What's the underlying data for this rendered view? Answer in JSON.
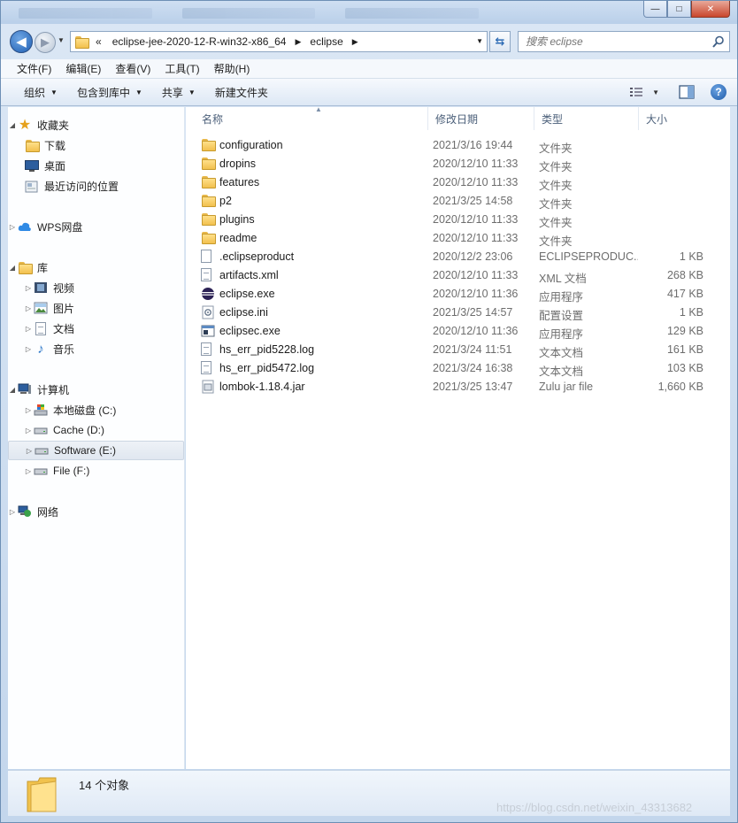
{
  "titlebar": {
    "background_tabs": [
      "",
      "",
      ""
    ],
    "minimize": "—",
    "maximize": "□",
    "close": "✕"
  },
  "nav": {
    "back_icon": "back-arrow-icon",
    "forward_icon": "forward-arrow-icon",
    "address_parts": [
      "eclipse-jee-2020-12-R-win32-x86_64",
      "eclipse"
    ],
    "address_overflow": "«",
    "refresh_icon": "refresh-icon",
    "search_placeholder": "搜索 eclipse"
  },
  "menubar": [
    "文件(F)",
    "编辑(E)",
    "查看(V)",
    "工具(T)",
    "帮助(H)"
  ],
  "toolbar": {
    "organize": "组织",
    "include_in_library": "包含到库中",
    "share": "共享",
    "new_folder": "新建文件夹"
  },
  "nav_pane": {
    "favorites": {
      "label": "收藏夹",
      "items": [
        "下载",
        "桌面",
        "最近访问的位置"
      ]
    },
    "wps": {
      "label": "WPS网盘"
    },
    "libraries": {
      "label": "库",
      "items": [
        "视频",
        "图片",
        "文档",
        "音乐"
      ]
    },
    "computer": {
      "label": "计算机",
      "items": [
        "本地磁盘 (C:)",
        "Cache (D:)",
        "Software (E:)",
        "File (F:)"
      ],
      "selected": "Software (E:)"
    },
    "network": {
      "label": "网络"
    }
  },
  "columns": {
    "name": "名称",
    "date": "修改日期",
    "type": "类型",
    "size": "大小"
  },
  "files": [
    {
      "name": "configuration",
      "date": "2021/3/16 19:44",
      "type": "文件夹",
      "size": "",
      "icon": "folder"
    },
    {
      "name": "dropins",
      "date": "2020/12/10 11:33",
      "type": "文件夹",
      "size": "",
      "icon": "folder"
    },
    {
      "name": "features",
      "date": "2020/12/10 11:33",
      "type": "文件夹",
      "size": "",
      "icon": "folder"
    },
    {
      "name": "p2",
      "date": "2021/3/25 14:58",
      "type": "文件夹",
      "size": "",
      "icon": "folder"
    },
    {
      "name": "plugins",
      "date": "2020/12/10 11:33",
      "type": "文件夹",
      "size": "",
      "icon": "folder"
    },
    {
      "name": "readme",
      "date": "2020/12/10 11:33",
      "type": "文件夹",
      "size": "",
      "icon": "folder"
    },
    {
      "name": ".eclipseproduct",
      "date": "2020/12/2 23:06",
      "type": "ECLIPSEPRODUC...",
      "size": "1 KB",
      "icon": "file"
    },
    {
      "name": "artifacts.xml",
      "date": "2020/12/10 11:33",
      "type": "XML 文档",
      "size": "268 KB",
      "icon": "xml"
    },
    {
      "name": "eclipse.exe",
      "date": "2020/12/10 11:36",
      "type": "应用程序",
      "size": "417 KB",
      "icon": "eclipse"
    },
    {
      "name": "eclipse.ini",
      "date": "2021/3/25 14:57",
      "type": "配置设置",
      "size": "1 KB",
      "icon": "ini"
    },
    {
      "name": "eclipsec.exe",
      "date": "2020/12/10 11:36",
      "type": "应用程序",
      "size": "129 KB",
      "icon": "console"
    },
    {
      "name": "hs_err_pid5228.log",
      "date": "2021/3/24 11:51",
      "type": "文本文档",
      "size": "161 KB",
      "icon": "text"
    },
    {
      "name": "hs_err_pid5472.log",
      "date": "2021/3/24 16:38",
      "type": "文本文档",
      "size": "103 KB",
      "icon": "text"
    },
    {
      "name": "lombok-1.18.4.jar",
      "date": "2021/3/25 13:47",
      "type": "Zulu jar file",
      "size": "1,660 KB",
      "icon": "jar"
    }
  ],
  "status": {
    "count_text": "14 个对象",
    "watermark": "https://blog.csdn.net/weixin_43313682"
  }
}
